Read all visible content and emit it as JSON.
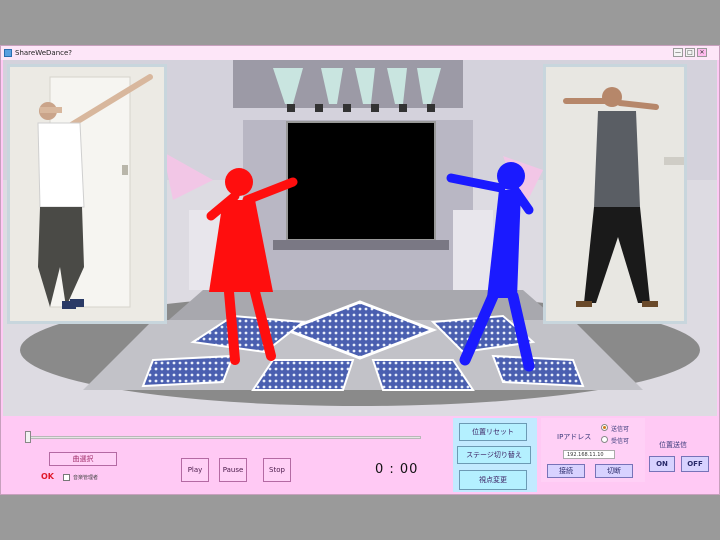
{
  "window": {
    "title": "ShareWeDance?",
    "min": "—",
    "max": "□",
    "close": "✕"
  },
  "controls": {
    "song_select": "曲選択",
    "ok": "OK",
    "song_manager": "音楽管理者",
    "play": "Play",
    "pause": "Pause",
    "stop": "Stop",
    "time": "0 : 00",
    "slider_position": 0
  },
  "view": {
    "reset_position": "位置リセット",
    "switch_stage": "ステージ切り替え",
    "change_viewpoint": "視点変更"
  },
  "network": {
    "ip_label": "IPアドレス",
    "send_ok": "送信可",
    "recv_ok": "受信可",
    "ip_value": "192.168.11.10",
    "connect": "接続",
    "disconnect": "切断"
  },
  "position_send": {
    "label": "位置送信",
    "on": "ON",
    "off": "OFF"
  },
  "colors": {
    "dancer_red": "#ff0e0e",
    "dancer_blue": "#1a1aff",
    "accent_pink": "#ffc9f4"
  }
}
